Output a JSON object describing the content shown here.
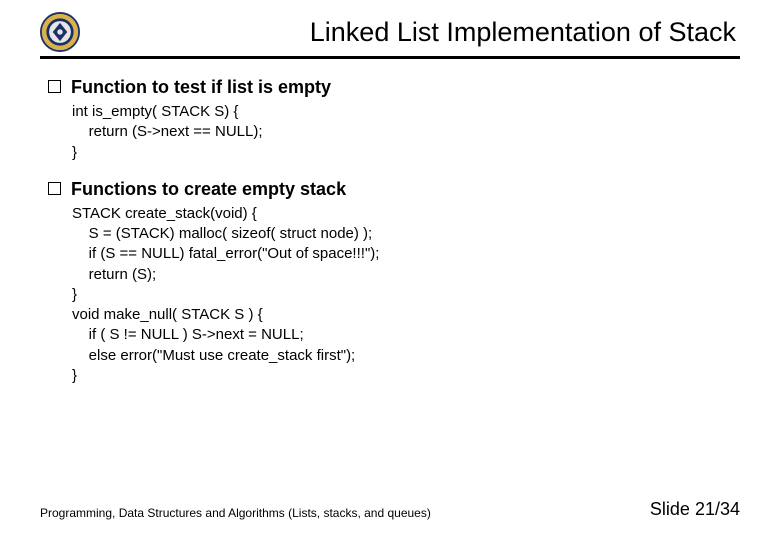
{
  "title": "Linked List Implementation of Stack",
  "bullets": [
    {
      "heading": "Function to test if list is empty",
      "code": [
        "int is_empty( STACK S) {",
        "    return (S->next == NULL);",
        "}"
      ]
    },
    {
      "heading": "Functions to create empty stack",
      "code": [
        "STACK create_stack(void) {",
        "    S = (STACK) malloc( sizeof( struct node) );",
        "    if (S == NULL) fatal_error(\"Out of space!!!\");",
        "    return (S);",
        "}",
        "",
        "void make_null( STACK S ) {",
        "    if ( S != NULL ) S->next = NULL;",
        "    else error(\"Must use create_stack first\");",
        "}"
      ]
    }
  ],
  "footer_left": "Programming, Data Structures and Algorithms  (Lists, stacks, and queues)",
  "footer_right": "Slide 21/34"
}
